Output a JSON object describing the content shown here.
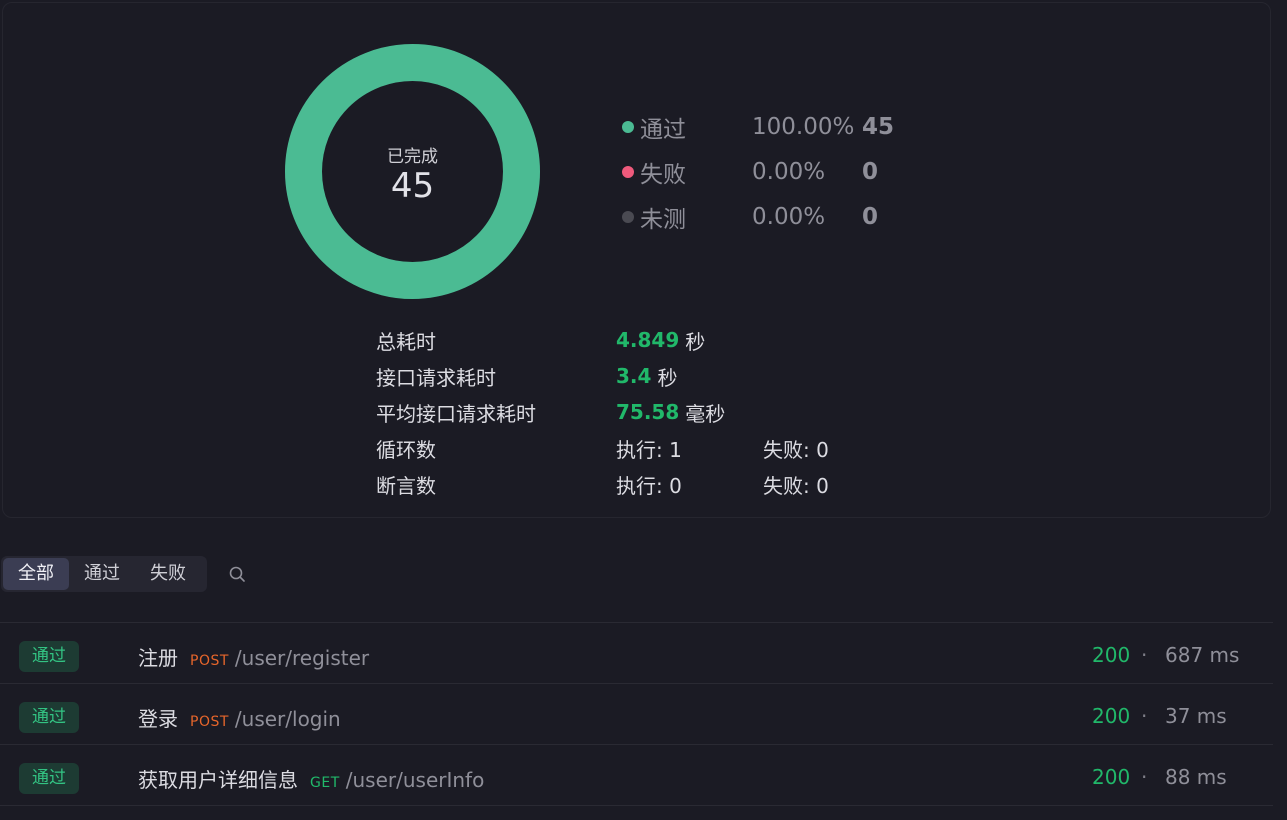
{
  "summary": {
    "donut": {
      "label": "已完成",
      "total": "45",
      "pass_fraction": 1.0,
      "pass_color": "#4bbb93"
    },
    "legend": [
      {
        "name": "通过",
        "percent": "100.00%",
        "count": "45",
        "color": "#4bbb93"
      },
      {
        "name": "失败",
        "percent": "0.00%",
        "count": "0",
        "color": "#ef5a7c"
      },
      {
        "name": "未测",
        "percent": "0.00%",
        "count": "0",
        "color": "#4a4a52"
      }
    ],
    "stats": {
      "total_time": {
        "label": "总耗时",
        "value": "4.849",
        "unit": "秒"
      },
      "request_time": {
        "label": "接口请求耗时",
        "value": "3.4",
        "unit": "秒"
      },
      "avg_request_time": {
        "label": "平均接口请求耗时",
        "value": "75.58",
        "unit": "毫秒"
      },
      "loops": {
        "label": "循环数",
        "exec": "执行: 1",
        "fail": "失败: 0"
      },
      "assertions": {
        "label": "断言数",
        "exec": "执行: 0",
        "fail": "失败: 0"
      }
    }
  },
  "filters": {
    "tabs": [
      {
        "label": "全部",
        "active": true
      },
      {
        "label": "通过",
        "active": false
      },
      {
        "label": "失败",
        "active": false
      }
    ],
    "search_icon": "search-icon"
  },
  "results": [
    {
      "status_badge": "通过",
      "name": "注册",
      "method": "POST",
      "path": "/user/register",
      "code": "200",
      "sep": "·",
      "time": "687 ms"
    },
    {
      "status_badge": "通过",
      "name": "登录",
      "method": "POST",
      "path": "/user/login",
      "code": "200",
      "sep": "·",
      "time": "37 ms"
    },
    {
      "status_badge": "通过",
      "name": "获取用户详细信息",
      "method": "GET",
      "path": "/user/userInfo",
      "code": "200",
      "sep": "·",
      "time": "88 ms"
    }
  ],
  "colors": {
    "accent_green": "#21b86a",
    "post": "#e5652b",
    "get": "#21b86a",
    "background": "#1b1b24"
  }
}
